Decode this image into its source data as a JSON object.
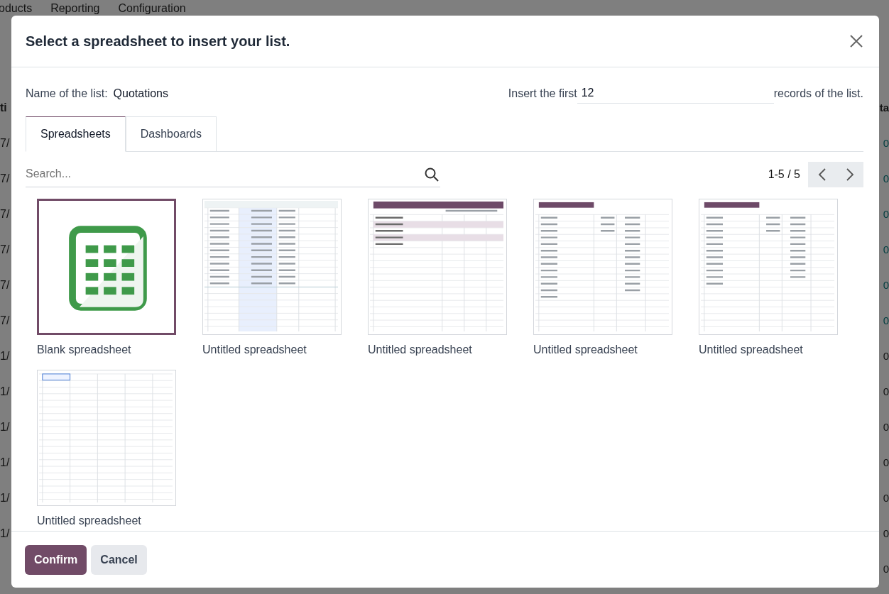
{
  "background": {
    "menu": [
      "oducts",
      "Reporting",
      "Configuration"
    ],
    "left_column": [
      {
        "text": "ti",
        "kind": "header"
      },
      {
        "text": "7/",
        "kind": "text"
      },
      {
        "text": "7/",
        "kind": "text"
      },
      {
        "text": "7/",
        "kind": "text"
      },
      {
        "text": "7/",
        "kind": "text"
      },
      {
        "text": "7/",
        "kind": "text"
      },
      {
        "text": "7/",
        "kind": "text"
      },
      {
        "text": "1/",
        "kind": "text"
      },
      {
        "text": "1/",
        "kind": "text"
      },
      {
        "text": "1/",
        "kind": "text"
      },
      {
        "text": "1/",
        "kind": "text"
      },
      {
        "text": "1/",
        "kind": "text"
      },
      {
        "text": "1/",
        "kind": "text"
      }
    ],
    "right_column": [
      {
        "text": "ta",
        "kind": "header"
      },
      {
        "text": "0",
        "kind": "link"
      },
      {
        "text": "0",
        "kind": "link"
      },
      {
        "text": "0",
        "kind": "link"
      },
      {
        "text": "0",
        "kind": "link"
      },
      {
        "text": "0",
        "kind": "link"
      },
      {
        "text": "0",
        "kind": "link"
      },
      {
        "text": "0",
        "kind": "text"
      },
      {
        "text": "0",
        "kind": "text"
      },
      {
        "text": "0",
        "kind": "text"
      },
      {
        "text": "0",
        "kind": "text"
      },
      {
        "text": "0",
        "kind": "text"
      },
      {
        "text": "0",
        "kind": "text"
      },
      {
        "text": "0",
        "kind": "text"
      }
    ]
  },
  "dialog": {
    "title": "Select a spreadsheet to insert your list.",
    "name_label": "Name of the list:",
    "name_value": "Quotations",
    "insert_label": "Insert the first",
    "insert_value": "12",
    "insert_suffix": "records of the list.",
    "tabs": [
      {
        "label": "Spreadsheets",
        "selected": true
      },
      {
        "label": "Dashboards",
        "selected": false
      }
    ],
    "search": {
      "placeholder": "Search..."
    },
    "pager": "1-5 / 5",
    "items": [
      {
        "label": "Blank spreadsheet",
        "selected": true,
        "preview": {
          "kind": "icon"
        }
      },
      {
        "label": "Untitled spreadsheet",
        "selected": false
      },
      {
        "label": "Untitled spreadsheet",
        "selected": false
      },
      {
        "label": "Untitled spreadsheet",
        "selected": false
      },
      {
        "label": "Untitled spreadsheet",
        "selected": false
      },
      {
        "label": "Untitled spreadsheet",
        "selected": false
      }
    ],
    "buttons": [
      {
        "label": "Confirm",
        "kind": "primary"
      },
      {
        "label": "Cancel",
        "kind": "secondary"
      }
    ]
  }
}
